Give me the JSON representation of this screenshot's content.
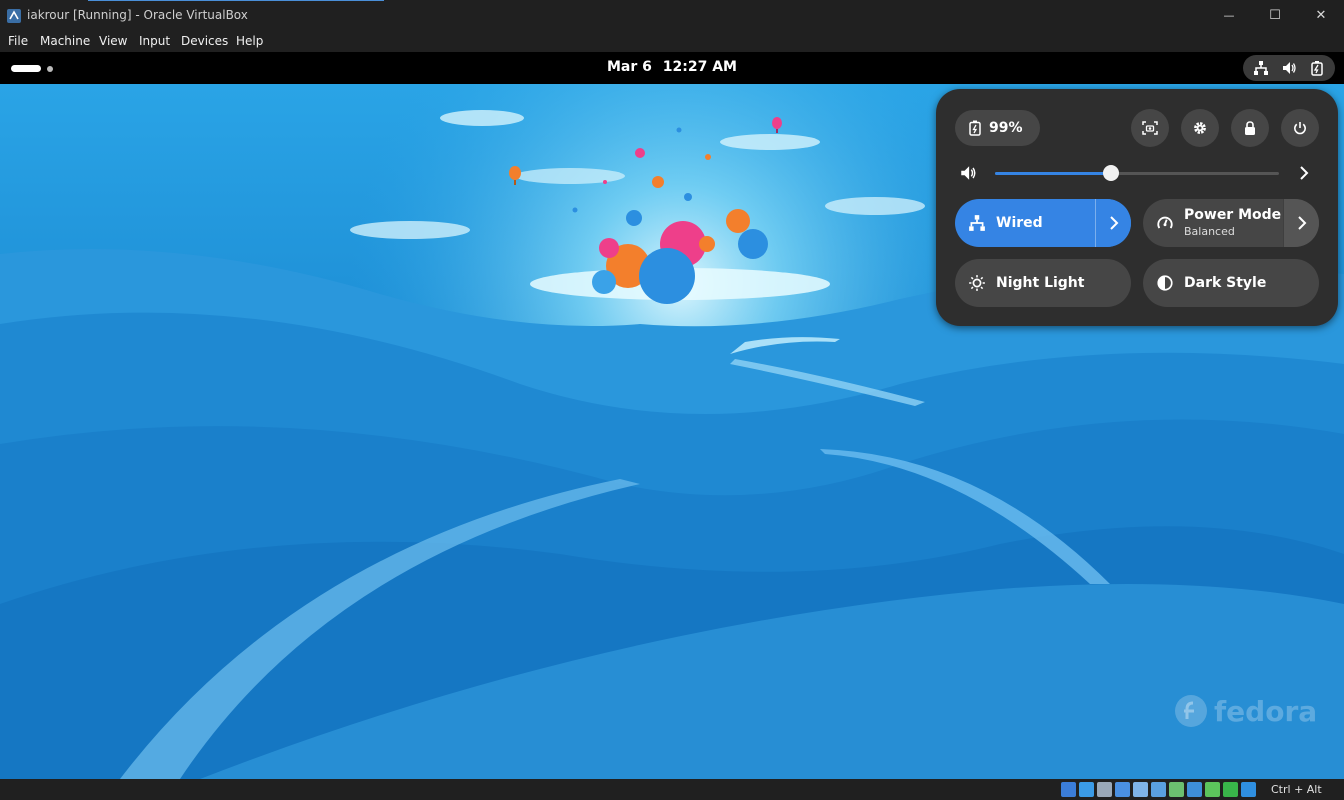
{
  "window": {
    "title": "iakrour [Running] - Oracle VirtualBox",
    "minimize_glyph": "—",
    "maximize_glyph": "☐",
    "close_glyph": "✕"
  },
  "menu": [
    "File",
    "Machine",
    "View",
    "Input",
    "Devices",
    "Help"
  ],
  "topbar": {
    "date": "Mar 6",
    "time": "12:27 AM",
    "status_icons": [
      "network-wired-icon",
      "speaker-icon",
      "battery-icon"
    ]
  },
  "quick_settings": {
    "battery_label": "99%",
    "buttons": [
      "screenshot-icon",
      "settings-gear-icon",
      "lock-icon",
      "power-icon"
    ],
    "volume_level": 0.41,
    "tiles": {
      "wired": {
        "label": "Wired",
        "active": true
      },
      "power_mode": {
        "label": "Power Mode",
        "subtitle": "Balanced"
      },
      "night_light": {
        "label": "Night Light"
      },
      "dark_style": {
        "label": "Dark Style"
      }
    }
  },
  "desktop": {
    "watermark": "fedora"
  },
  "statusbar": {
    "host_key": "Ctrl + Alt",
    "indicator_colors": [
      "#3b7dd8",
      "#3b9be6",
      "#9aa8b8",
      "#4a90e2",
      "#7fb4e8",
      "#5aa0e0",
      "#6cc070",
      "#3e8fd8",
      "#5cc45c",
      "#39b54a",
      "#2f8fe0"
    ]
  },
  "colors": {
    "accent": "#3584e4",
    "panel_bg": "#2e2e2e",
    "tile_bg": "#464646"
  }
}
